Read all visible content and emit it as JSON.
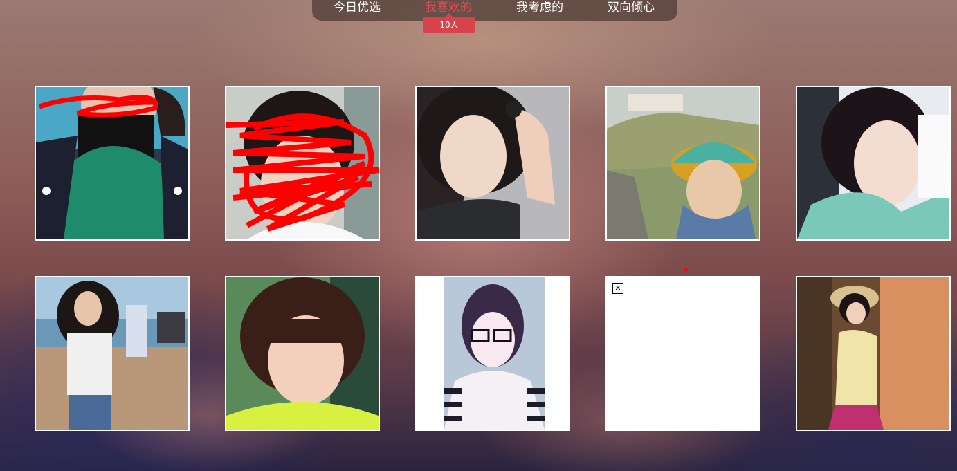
{
  "tabs": [
    {
      "label": "今日优选",
      "active": false
    },
    {
      "label": "我喜欢的",
      "active": true
    },
    {
      "label": "我考虑的",
      "active": false
    },
    {
      "label": "双向倾心",
      "active": false
    }
  ],
  "liked_count_badge": "10人",
  "photos": [
    {
      "id": "photo-1",
      "status": "loaded"
    },
    {
      "id": "photo-2",
      "status": "loaded"
    },
    {
      "id": "photo-3",
      "status": "loaded"
    },
    {
      "id": "photo-4",
      "status": "loaded"
    },
    {
      "id": "photo-5",
      "status": "loaded"
    },
    {
      "id": "photo-6",
      "status": "loaded"
    },
    {
      "id": "photo-7",
      "status": "loaded"
    },
    {
      "id": "photo-8",
      "status": "loaded"
    },
    {
      "id": "photo-9",
      "status": "broken",
      "icon": "broken-image-icon"
    },
    {
      "id": "photo-10",
      "status": "loaded"
    }
  ],
  "colors": {
    "active_tab": "#e74a55",
    "badge_bg": "#d9424c",
    "tab_text": "#ffffff"
  }
}
